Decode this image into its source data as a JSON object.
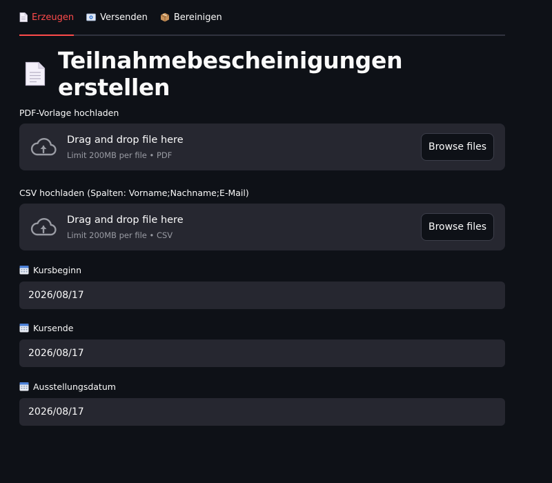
{
  "tabs": [
    {
      "label": "Erzeugen",
      "icon": "page-icon",
      "active": true
    },
    {
      "label": "Versenden",
      "icon": "envelope-icon",
      "active": false
    },
    {
      "label": "Bereinigen",
      "icon": "package-icon",
      "active": false
    }
  ],
  "page": {
    "title": "Teilnahmebescheinigungen erstellen",
    "title_icon": "page-icon"
  },
  "uploaders": [
    {
      "label": "PDF-Vorlage hochladen",
      "drop_text": "Drag and drop file here",
      "limit_text": "Limit 200MB per file • PDF",
      "button_label": "Browse files"
    },
    {
      "label": "CSV hochladen (Spalten: Vorname;Nachname;E-Mail)",
      "drop_text": "Drag and drop file here",
      "limit_text": "Limit 200MB per file • CSV",
      "button_label": "Browse files"
    }
  ],
  "dates": [
    {
      "label": "Kursbeginn",
      "value": "2026/08/17"
    },
    {
      "label": "Kursende",
      "value": "2026/08/17"
    },
    {
      "label": "Ausstellungsdatum",
      "value": "2026/08/17"
    }
  ],
  "colors": {
    "background": "#0e1117",
    "surface": "#262730",
    "accent": "#ff4b4b",
    "text": "#fafafa",
    "muted": "#9a9ca4"
  }
}
